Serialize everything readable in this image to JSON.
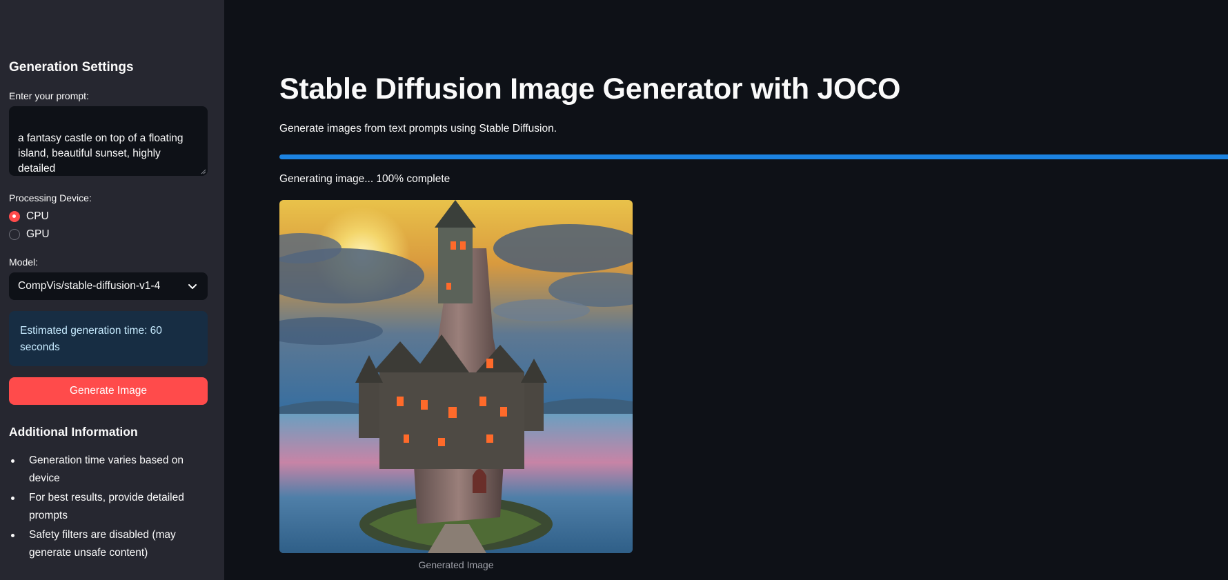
{
  "sidebar": {
    "title": "Generation Settings",
    "prompt_label": "Enter your prompt:",
    "prompt_value": "a fantasy castle on top of a floating\nisland, beautiful sunset, highly detailed",
    "device_label": "Processing Device:",
    "device_options": [
      {
        "label": "CPU",
        "selected": true
      },
      {
        "label": "GPU",
        "selected": false
      }
    ],
    "model_label": "Model:",
    "model_value": "CompVis/stable-diffusion-v1-4",
    "estimate_text": "Estimated generation time: 60 seconds",
    "generate_button": "Generate Image",
    "info_title": "Additional Information",
    "info_items": [
      "Generation time varies based on device",
      "For best results, provide detailed prompts",
      "Safety filters are disabled (may generate unsafe content)"
    ]
  },
  "main": {
    "title": "Stable Diffusion Image Generator with JOCO",
    "subtitle": "Generate images from text prompts using Stable Diffusion.",
    "progress_percent": 100,
    "progress_text": "Generating image... 100% complete",
    "image_caption": "Generated Image"
  },
  "colors": {
    "accent": "#ff4b4b",
    "progress": "#1c83e1",
    "info_bg": "#172d43",
    "sidebar_bg": "#262730",
    "main_bg": "#0e1117"
  }
}
